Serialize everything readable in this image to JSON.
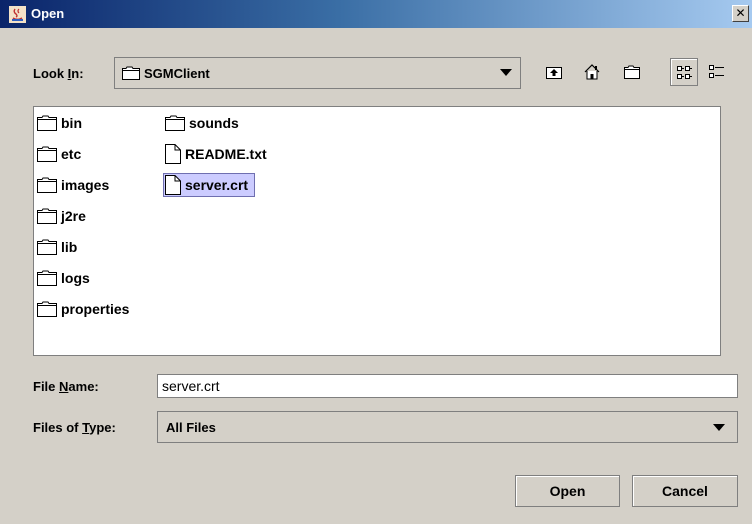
{
  "window": {
    "title": "Open",
    "close_glyph": "✕"
  },
  "look_in": {
    "label_pre": "Look ",
    "label_mnemonic": "I",
    "label_post": "n:",
    "value": "SGMClient"
  },
  "toolbar": {
    "buttons": [
      {
        "name": "up-folder-button",
        "icon": "up-folder-icon"
      },
      {
        "name": "home-button",
        "icon": "home-icon"
      },
      {
        "name": "new-folder-button",
        "icon": "new-folder-icon"
      },
      {
        "name": "list-view-button",
        "icon": "list-view-icon",
        "selected": true
      },
      {
        "name": "details-view-button",
        "icon": "details-view-icon"
      }
    ]
  },
  "files": {
    "col1": [
      {
        "name": "bin",
        "type": "folder"
      },
      {
        "name": "etc",
        "type": "folder"
      },
      {
        "name": "images",
        "type": "folder"
      },
      {
        "name": "j2re",
        "type": "folder"
      },
      {
        "name": "lib",
        "type": "folder"
      },
      {
        "name": "logs",
        "type": "folder"
      },
      {
        "name": "properties",
        "type": "folder"
      }
    ],
    "col2": [
      {
        "name": "sounds",
        "type": "folder"
      },
      {
        "name": "README.txt",
        "type": "file"
      },
      {
        "name": "server.crt",
        "type": "file",
        "selected": true
      }
    ]
  },
  "file_name": {
    "label_pre": "File ",
    "label_mnemonic": "N",
    "label_post": "ame:",
    "value": "server.crt"
  },
  "files_of_type": {
    "label_pre": "Files of ",
    "label_mnemonic": "T",
    "label_post": "ype:",
    "value": "All Files"
  },
  "buttons": {
    "open": "Open",
    "cancel": "Cancel"
  },
  "colors": {
    "selection": "#ccccff",
    "dialog_bg": "#d4d0c8",
    "title_start": "#0a246a"
  }
}
